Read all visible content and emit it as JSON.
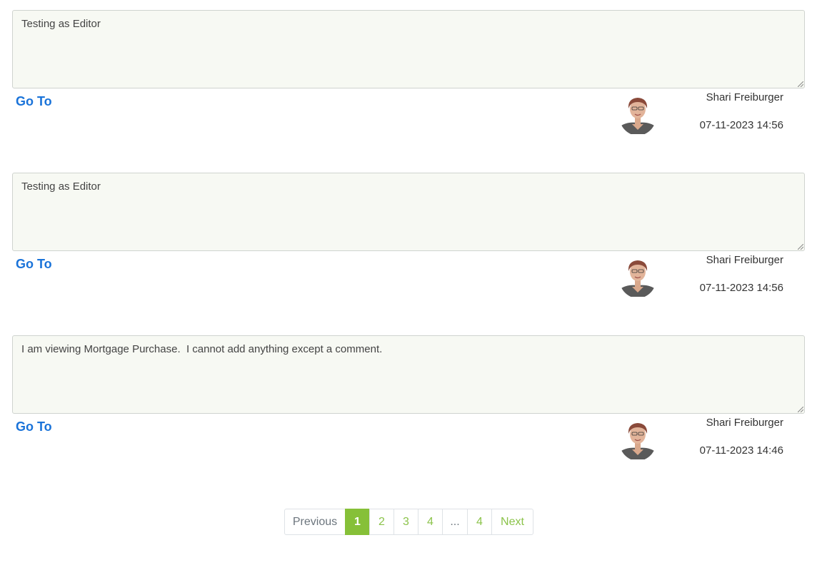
{
  "comments": [
    {
      "text": "Testing as Editor",
      "link_label": "Go To",
      "author": "Shari Freiburger",
      "date": "07-11-2023 14:56",
      "avatar_icon": "user-avatar-photo"
    },
    {
      "text": "Testing as Editor",
      "link_label": "Go To",
      "author": "Shari Freiburger",
      "date": "07-11-2023 14:56",
      "avatar_icon": "user-avatar-photo"
    },
    {
      "text": "I am viewing Mortgage Purchase.  I cannot add anything except a comment.",
      "link_label": "Go To",
      "author": "Shari Freiburger",
      "date": "07-11-2023 14:46",
      "avatar_icon": "user-avatar-photo"
    }
  ],
  "pagination": {
    "previous_label": "Previous",
    "pages": [
      "1",
      "2",
      "3",
      "4",
      "...",
      "4"
    ],
    "active_page": "1",
    "next_label": "Next"
  },
  "colors": {
    "link": "#1a73d9",
    "accent": "#86c038",
    "comment_background": "#f7f9f3"
  }
}
